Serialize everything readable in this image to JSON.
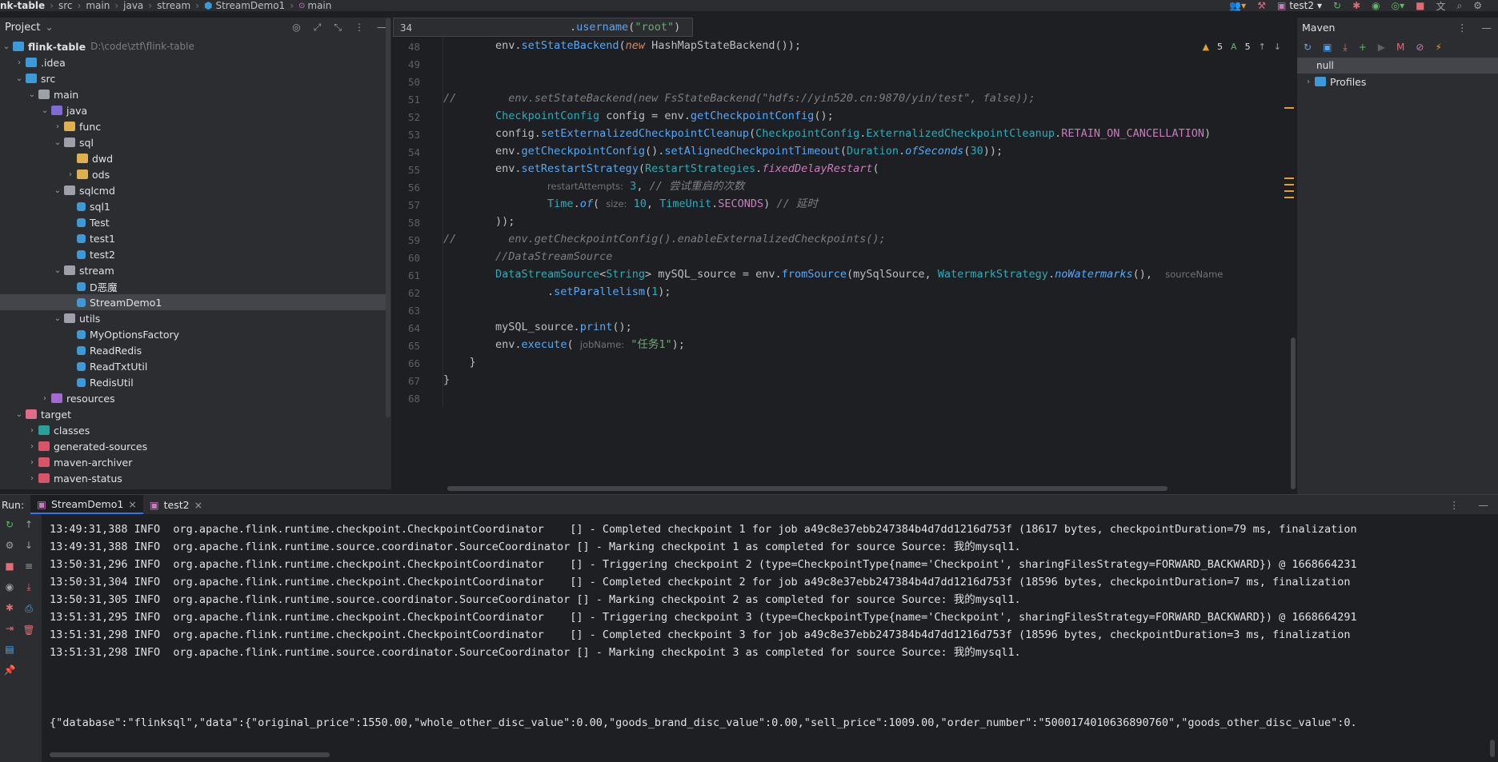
{
  "navbar": {
    "crumbs": [
      "nk-table",
      "src",
      "main",
      "java",
      "stream",
      "StreamDemo1",
      "main"
    ],
    "run_config": "test2"
  },
  "project": {
    "title": "Project",
    "tree": [
      {
        "depth": 0,
        "arrow": "open",
        "icon": "module",
        "label": "flink-table",
        "path": "D:\\code\\ztf\\flink-table",
        "bold": true
      },
      {
        "depth": 1,
        "arrow": "closed",
        "icon": "folder-idea",
        "label": ".idea"
      },
      {
        "depth": 1,
        "arrow": "open",
        "icon": "folder-src",
        "label": "src"
      },
      {
        "depth": 2,
        "arrow": "open",
        "icon": "folder",
        "label": "main"
      },
      {
        "depth": 3,
        "arrow": "open",
        "icon": "folder-java",
        "label": "java"
      },
      {
        "depth": 4,
        "arrow": "closed",
        "icon": "folder-yellow",
        "label": "func"
      },
      {
        "depth": 4,
        "arrow": "open",
        "icon": "package",
        "label": "sql"
      },
      {
        "depth": 5,
        "arrow": "none",
        "icon": "folder-yellow",
        "label": "dwd"
      },
      {
        "depth": 5,
        "arrow": "closed",
        "icon": "folder-yellow",
        "label": "ods"
      },
      {
        "depth": 4,
        "arrow": "open",
        "icon": "package",
        "label": "sqlcmd"
      },
      {
        "depth": 5,
        "arrow": "none",
        "icon": "class",
        "label": "sql1"
      },
      {
        "depth": 5,
        "arrow": "none",
        "icon": "class",
        "label": "Test"
      },
      {
        "depth": 5,
        "arrow": "none",
        "icon": "class",
        "label": "test1"
      },
      {
        "depth": 5,
        "arrow": "none",
        "icon": "class",
        "label": "test2"
      },
      {
        "depth": 4,
        "arrow": "open",
        "icon": "package",
        "label": "stream"
      },
      {
        "depth": 5,
        "arrow": "none",
        "icon": "class",
        "label": "D恶魔"
      },
      {
        "depth": 5,
        "arrow": "none",
        "icon": "class",
        "label": "StreamDemo1",
        "selected": true
      },
      {
        "depth": 4,
        "arrow": "open",
        "icon": "package",
        "label": "utils"
      },
      {
        "depth": 5,
        "arrow": "none",
        "icon": "class",
        "label": "MyOptionsFactory"
      },
      {
        "depth": 5,
        "arrow": "none",
        "icon": "class",
        "label": "ReadRedis"
      },
      {
        "depth": 5,
        "arrow": "none",
        "icon": "class",
        "label": "ReadTxtUtil"
      },
      {
        "depth": 5,
        "arrow": "none",
        "icon": "class",
        "label": "RedisUtil"
      },
      {
        "depth": 3,
        "arrow": "closed",
        "icon": "folder-res",
        "label": "resources"
      },
      {
        "depth": 1,
        "arrow": "open",
        "icon": "folder-target",
        "label": "target"
      },
      {
        "depth": 2,
        "arrow": "closed",
        "icon": "folder-teal",
        "label": "classes"
      },
      {
        "depth": 2,
        "arrow": "closed",
        "icon": "folder-red",
        "label": "generated-sources"
      },
      {
        "depth": 2,
        "arrow": "closed",
        "icon": "folder-red",
        "label": "maven-archiver"
      },
      {
        "depth": 2,
        "arrow": "closed",
        "icon": "folder-red",
        "label": "maven-status"
      }
    ]
  },
  "editor": {
    "sticky": {
      "line": "34",
      "text": ".username(\"root\")"
    },
    "inspections": {
      "warnings": "5",
      "typos": "5"
    },
    "line_numbers": [
      "48",
      "49",
      "50",
      "51",
      "52",
      "53",
      "54",
      "55",
      "56",
      "57",
      "58",
      "59",
      "60",
      "61",
      "62",
      "63",
      "64",
      "65",
      "66",
      "67",
      "68"
    ]
  },
  "maven": {
    "title": "Maven",
    "null_label": "null",
    "profiles_label": "Profiles"
  },
  "run": {
    "label": "Run:",
    "tabs": [
      "StreamDemo1",
      "test2"
    ],
    "log_lines": [
      "13:49:31,388 INFO  org.apache.flink.runtime.checkpoint.CheckpointCoordinator    [] - Completed checkpoint 1 for job a49c8e37ebb247384b4d7dd1216d753f (18617 bytes, checkpointDuration=79 ms, finalization",
      "13:49:31,388 INFO  org.apache.flink.runtime.source.coordinator.SourceCoordinator [] - Marking checkpoint 1 as completed for source Source: 我的mysql1.",
      "13:50:31,296 INFO  org.apache.flink.runtime.checkpoint.CheckpointCoordinator    [] - Triggering checkpoint 2 (type=CheckpointType{name='Checkpoint', sharingFilesStrategy=FORWARD_BACKWARD}) @ 1668664231",
      "13:50:31,304 INFO  org.apache.flink.runtime.checkpoint.CheckpointCoordinator    [] - Completed checkpoint 2 for job a49c8e37ebb247384b4d7dd1216d753f (18596 bytes, checkpointDuration=7 ms, finalization",
      "13:50:31,305 INFO  org.apache.flink.runtime.source.coordinator.SourceCoordinator [] - Marking checkpoint 2 as completed for source Source: 我的mysql1.",
      "13:51:31,295 INFO  org.apache.flink.runtime.checkpoint.CheckpointCoordinator    [] - Triggering checkpoint 3 (type=CheckpointType{name='Checkpoint', sharingFilesStrategy=FORWARD_BACKWARD}) @ 1668664291",
      "13:51:31,298 INFO  org.apache.flink.runtime.checkpoint.CheckpointCoordinator    [] - Completed checkpoint 3 for job a49c8e37ebb247384b4d7dd1216d753f (18596 bytes, checkpointDuration=3 ms, finalization",
      "13:51:31,298 INFO  org.apache.flink.runtime.source.coordinator.SourceCoordinator [] - Marking checkpoint 3 as completed for source Source: 我的mysql1."
    ],
    "json_line": "{\"database\":\"flinksql\",\"data\":{\"original_price\":1550.00,\"whole_other_disc_value\":0.00,\"goods_brand_disc_value\":0.00,\"sell_price\":1009.00,\"order_number\":\"5000174010636890760\",\"goods_other_disc_value\":0."
  }
}
